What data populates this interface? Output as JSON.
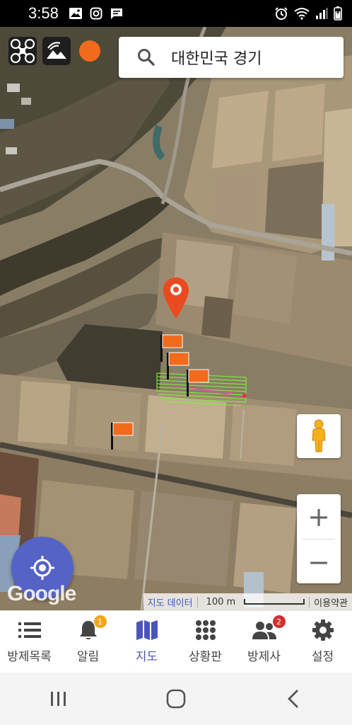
{
  "status_bar": {
    "time": "3:58",
    "left_icons": [
      "image-icon",
      "instagram-icon",
      "message-icon"
    ],
    "right_icons": [
      "alarm-icon",
      "wifi-icon",
      "signal-icon",
      "battery-icon"
    ]
  },
  "map": {
    "search": {
      "text": "대한민국 경기"
    },
    "top_controls": [
      "drone-icon",
      "satellite-layer-icon",
      "connection-status-dot"
    ],
    "status_dot_color": "#f26a1b",
    "marker_color": "#ea4a1f",
    "flag_color": "#f26a1b",
    "flight_path_color": "#7cf23a",
    "zoom_in": "+",
    "zoom_out": "−",
    "google_logo": "Google",
    "attribution": {
      "map_data": "지도 데이터",
      "scale": "100 m",
      "terms": "이용약관"
    }
  },
  "bottom_nav": {
    "active": "지도",
    "accent": "#4b55b8",
    "items": [
      {
        "label": "방제목록",
        "icon": "list-icon"
      },
      {
        "label": "알림",
        "icon": "bell-icon",
        "badge": "1",
        "badge_color": "#f2a81b"
      },
      {
        "label": "지도",
        "icon": "map-icon"
      },
      {
        "label": "상황판",
        "icon": "grid-icon"
      },
      {
        "label": "방제사",
        "icon": "people-icon",
        "badge": "2",
        "badge_color": "#d32f2f"
      },
      {
        "label": "설정",
        "icon": "gear-icon"
      }
    ]
  },
  "system_nav": [
    "recents-icon",
    "home-icon",
    "back-icon"
  ]
}
